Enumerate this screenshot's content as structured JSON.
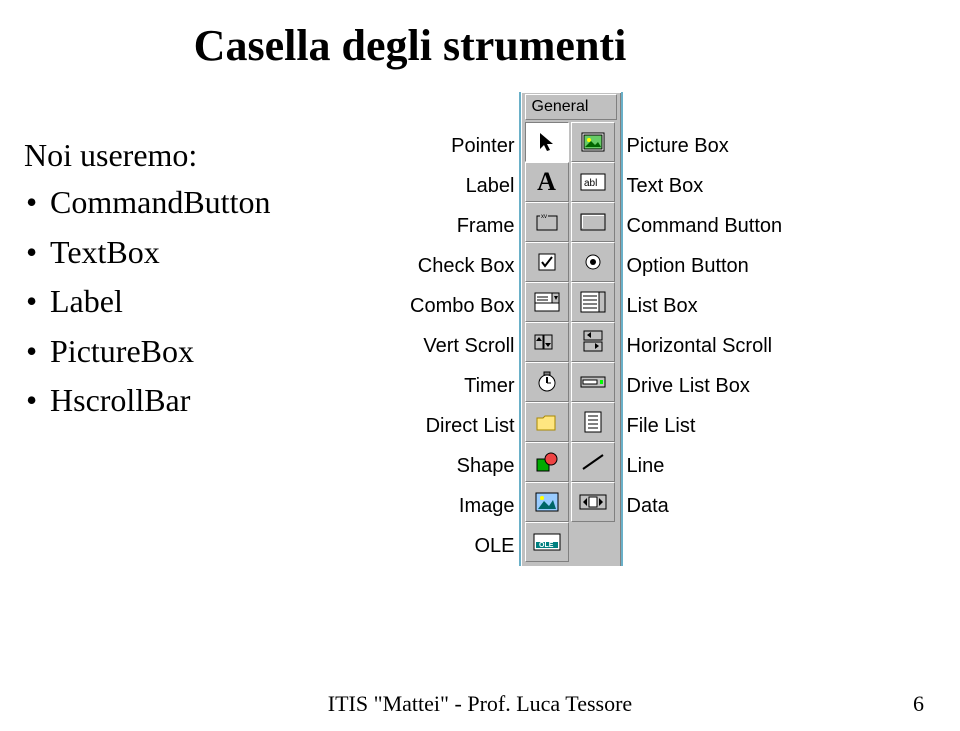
{
  "title": "Casella degli strumenti",
  "intro": "Noi useremo:",
  "bullets": [
    "CommandButton",
    "TextBox",
    "Label",
    "PictureBox",
    "HscrollBar"
  ],
  "toolbox": {
    "header": "General",
    "left_labels": [
      "Pointer",
      "Label",
      "Frame",
      "Check Box",
      "Combo Box",
      "Vert Scroll",
      "Timer",
      "Direct List",
      "Shape",
      "Image",
      "OLE"
    ],
    "right_labels": [
      "Picture Box",
      "Text Box",
      "Command Button",
      "Option Button",
      "List Box",
      "Horizontal Scroll",
      "Drive List Box",
      "File List",
      "Line",
      "Data"
    ]
  },
  "footer": {
    "center": "ITIS \"Mattei\"  -  Prof. Luca Tessore",
    "page": "6"
  }
}
